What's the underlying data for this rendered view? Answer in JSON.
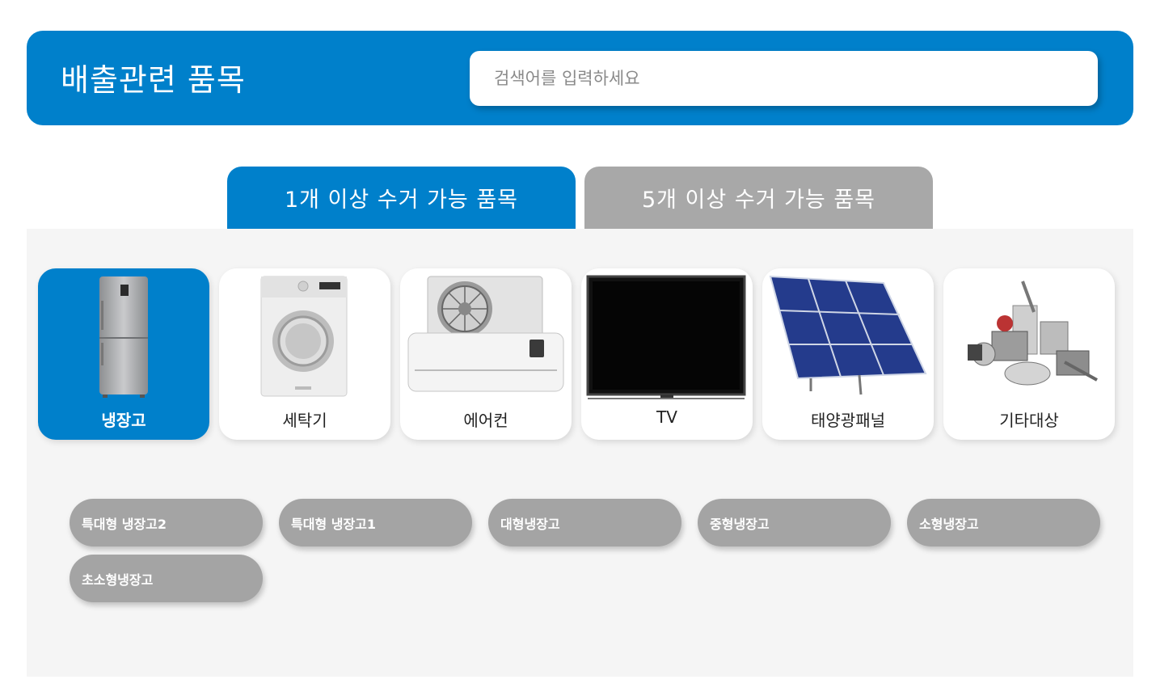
{
  "header": {
    "title": "배출관련 품목",
    "search_placeholder": "검색어를 입력하세요",
    "search_value": ""
  },
  "tabs": [
    {
      "label": "1개 이상 수거 가능 품목",
      "active": true
    },
    {
      "label": "5개 이상 수거 가능 품목",
      "active": false
    }
  ],
  "categories": [
    {
      "label": "냉장고",
      "icon": "refrigerator-icon",
      "selected": true
    },
    {
      "label": "세탁기",
      "icon": "washing-machine-icon",
      "selected": false
    },
    {
      "label": "에어컨",
      "icon": "air-conditioner-icon",
      "selected": false
    },
    {
      "label": "TV",
      "icon": "tv-icon",
      "selected": false
    },
    {
      "label": "태양광패널",
      "icon": "solar-panel-icon",
      "selected": false
    },
    {
      "label": "기타대상",
      "icon": "appliances-icon",
      "selected": false
    }
  ],
  "subitems": [
    {
      "label": "특대형 냉장고2"
    },
    {
      "label": "특대형 냉장고1"
    },
    {
      "label": "대형냉장고"
    },
    {
      "label": "중형냉장고"
    },
    {
      "label": "소형냉장고"
    },
    {
      "label": "초소형냉장고"
    }
  ],
  "colors": {
    "accent": "#0080cb",
    "inactive_tab": "#a8a8a8",
    "pill": "#a4a4a4",
    "panel_bg": "#f5f5f5"
  }
}
